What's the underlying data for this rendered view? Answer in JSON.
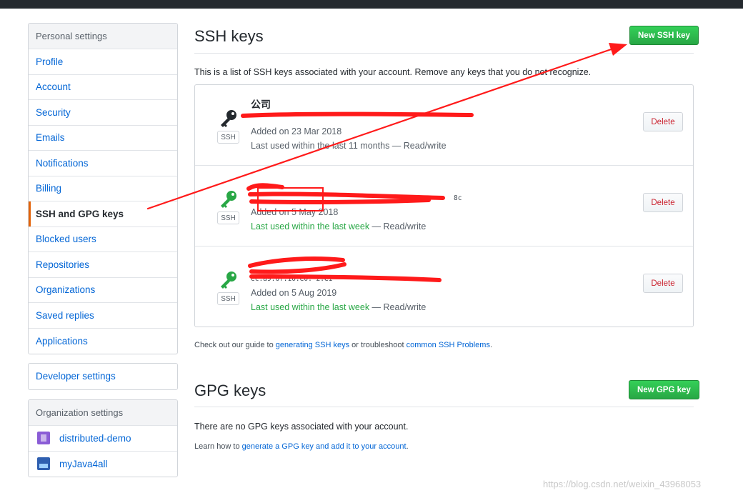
{
  "sidebar": {
    "heading": "Personal settings",
    "items": [
      {
        "label": "Profile"
      },
      {
        "label": "Account"
      },
      {
        "label": "Security"
      },
      {
        "label": "Emails"
      },
      {
        "label": "Notifications"
      },
      {
        "label": "Billing"
      },
      {
        "label": "SSH and GPG keys",
        "selected": true
      },
      {
        "label": "Blocked users"
      },
      {
        "label": "Repositories"
      },
      {
        "label": "Organizations"
      },
      {
        "label": "Saved replies"
      },
      {
        "label": "Applications"
      }
    ],
    "developer": "Developer settings",
    "org_heading": "Organization settings",
    "orgs": [
      {
        "label": "distributed-demo",
        "icon": "org-avatar-icon"
      },
      {
        "label": "myJava4all",
        "icon": "org-avatar-icon"
      }
    ]
  },
  "ssh": {
    "title": "SSH keys",
    "new_button": "New SSH key",
    "description": "This is a list of SSH keys associated with your account. Remove any keys that you do not recognize.",
    "badge": "SSH",
    "delete_label": "Delete",
    "keys": [
      {
        "title": "公司",
        "fingerprint": "",
        "added": "Added on 23 Mar 2018",
        "last_used": "Last used within the last 11 months",
        "access": " — Read/write",
        "recent": false,
        "icon_color": "#24292e"
      },
      {
        "title": "",
        "fingerprint": "8c",
        "added": "Added on 5 May 2018",
        "last_used": "Last used within the last week",
        "access": " — Read/write",
        "recent": true,
        "icon_color": "#28a745"
      },
      {
        "title": "",
        "fingerprint": "ec:a9:6f:10:e0:                         2:e1",
        "added": "Added on 5 Aug 2019",
        "last_used": "Last used within the last week",
        "access": " — Read/write",
        "recent": true,
        "icon_color": "#28a745"
      }
    ],
    "guide": {
      "prefix": "Check out our guide to ",
      "link1": "generating SSH keys",
      "middle": " or troubleshoot ",
      "link2": "common SSH Problems",
      "suffix": "."
    }
  },
  "gpg": {
    "title": "GPG keys",
    "new_button": "New GPG key",
    "empty": "There are no GPG keys associated with your account.",
    "learn": {
      "prefix": "Learn how to ",
      "link": "generate a GPG key and add it to your account",
      "suffix": "."
    }
  },
  "watermark": "https://blog.csdn.net/weixin_43968053",
  "colors": {
    "primary_green": "#28a745",
    "link_blue": "#0366d6",
    "danger_red": "#cb2431",
    "annotation_red": "#ff1a1a",
    "selected_accent": "#e36209"
  }
}
